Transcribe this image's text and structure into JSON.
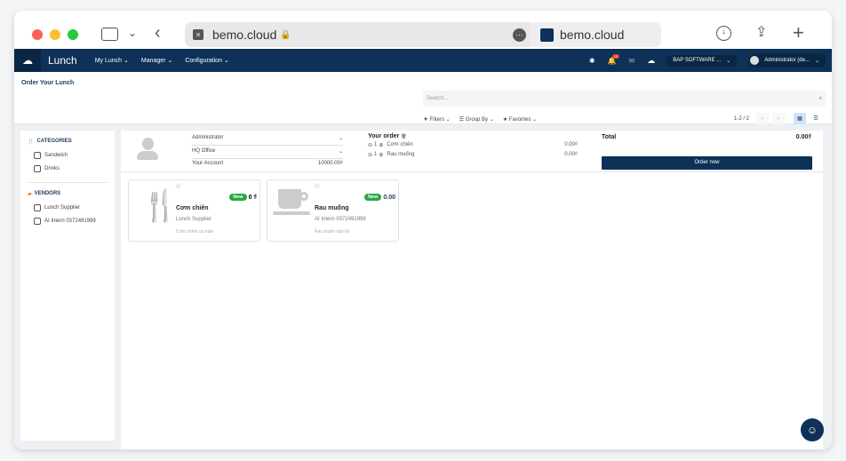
{
  "browser": {
    "url": "bemo.cloud",
    "tab_title": "bemo.cloud"
  },
  "nav": {
    "app": "Lunch",
    "menus": [
      "My Lunch",
      "Manager",
      "Configuration"
    ],
    "notif_count": "10",
    "company": "BAP SOFTWARE ...",
    "user": "Administrator (de..."
  },
  "cp": {
    "title": "Order Your Lunch",
    "search_placeholder": "Search...",
    "filters": "Filters",
    "group_by": "Group By",
    "favorites": "Favorites",
    "pager": "1-2 / 2"
  },
  "sidebar": {
    "categories_title": "CATEGORIES",
    "categories": [
      "Sandwich",
      "Drinks"
    ],
    "vendors_title": "VENDORS",
    "vendors": [
      "Lunch Supplier",
      "AI Intern 0372491999"
    ]
  },
  "order": {
    "user": "Administrator",
    "location": "HQ Office",
    "account_label": "Your Account",
    "account_value": "10000.00₫",
    "title": "Your order",
    "lines": [
      {
        "qty": "1",
        "name": "Cơm chiên",
        "price": "0.00₫"
      },
      {
        "qty": "1",
        "name": "Rau muống",
        "price": "0.00₫"
      }
    ],
    "total_label": "Total",
    "total_value": "0.00₫",
    "order_button": "Order now"
  },
  "products": [
    {
      "name": "Cơm chiên",
      "vendor": "Lunch Supplier",
      "desc": "Cơm chiên cá mặn",
      "badge": "New",
      "price": "0 ₫",
      "icon": "fork-knife-icon"
    },
    {
      "name": "Rau muống",
      "vendor": "AI Intern 0372491999",
      "desc": "Rau muốn xào tỏi",
      "badge": "New",
      "price": "0.00",
      "icon": "cup-icon"
    }
  ],
  "colors": {
    "nav": "#0d3157",
    "badge": "#28a745",
    "notif": "#e53935"
  }
}
